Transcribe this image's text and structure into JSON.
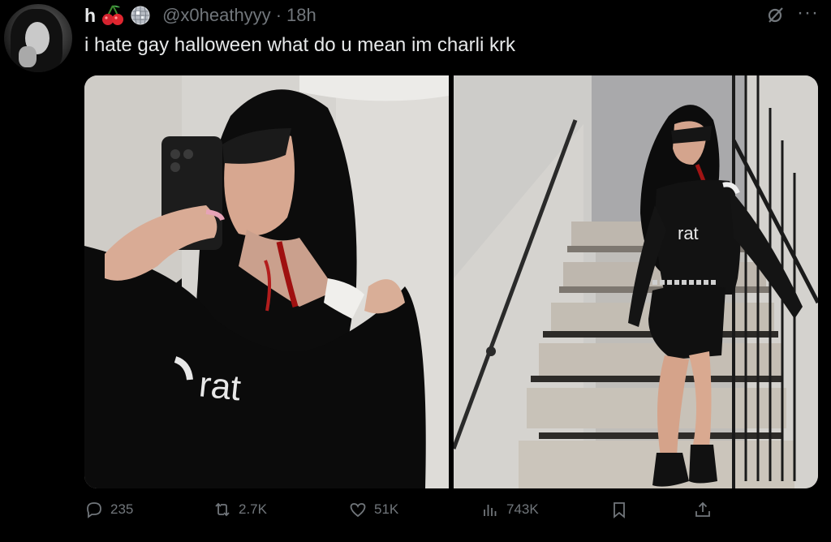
{
  "author": {
    "display_name": "h",
    "handle": "@x0heathyyy",
    "separator": "·",
    "time": "18h"
  },
  "icons": {
    "name_emoji_1": "cherries-icon",
    "name_emoji_2": "disco-ball-icon",
    "grok": "grok-slash-icon",
    "more": "more-dots-icon"
  },
  "tweet": {
    "text": "i hate gay halloween what do u mean im charli krk"
  },
  "photos": {
    "left_shirt_text": "rat",
    "right_shirt_text": "rat"
  },
  "actions": {
    "replies": "235",
    "reposts": "2.7K",
    "likes": "51K",
    "views": "743K"
  },
  "colors": {
    "background": "#000000",
    "text_primary": "#e7e9ea",
    "text_secondary": "#71767b"
  }
}
